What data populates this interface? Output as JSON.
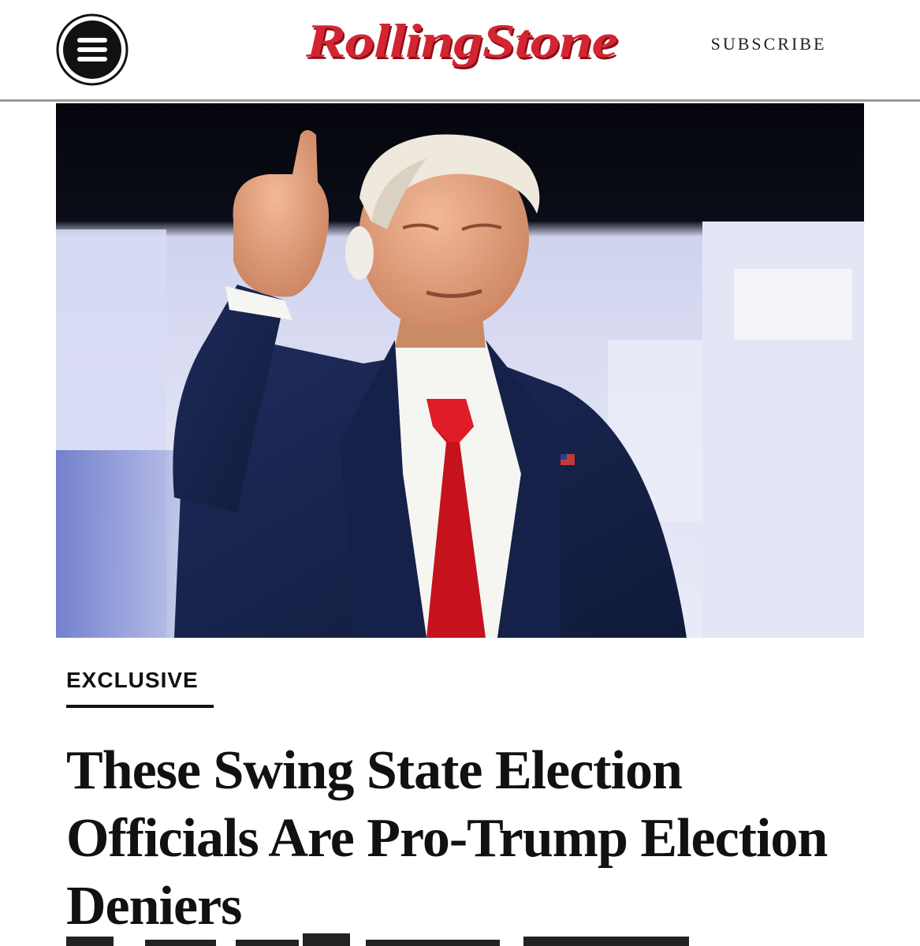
{
  "header": {
    "logo_text": "RollingStone",
    "subscribe_label": "SUBSCRIBE",
    "menu_icon": "hamburger-menu-icon",
    "brand_color": "#d32531"
  },
  "hero": {
    "image_alt": "Donald Trump pointing upward at a podium, wearing a navy suit, white shirt and red tie"
  },
  "article": {
    "tag": "EXCLUSIVE",
    "headline": "These Swing State Election Officials Are Pro-Trump Election Deniers"
  }
}
